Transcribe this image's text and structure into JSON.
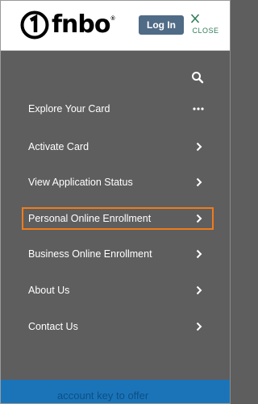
{
  "header": {
    "logo_text": "fnbo",
    "logo_reg": "®",
    "login_label": "Log In",
    "close_label": "CLOSE"
  },
  "menu": {
    "items": [
      {
        "label": "Explore Your Card",
        "icon": "more-dots-icon"
      },
      {
        "label": "Activate Card",
        "icon": "chevron-right-icon"
      },
      {
        "label": "View Application Status",
        "icon": "chevron-right-icon"
      },
      {
        "label": "Personal Online Enrollment",
        "icon": "chevron-right-icon",
        "highlighted": true
      },
      {
        "label": "Business Online Enrollment",
        "icon": "chevron-right-icon"
      },
      {
        "label": "About Us",
        "icon": "chevron-right-icon"
      },
      {
        "label": "Contact Us",
        "icon": "chevron-right-icon"
      }
    ]
  },
  "footer": {
    "partial_text": "account key to offer"
  },
  "colors": {
    "menu_bg": "#5e5e5e",
    "login_bg": "#4f6b86",
    "close": "#2f7d5a",
    "highlight": "#f07c1a",
    "footer_bg": "#1b74b8"
  }
}
